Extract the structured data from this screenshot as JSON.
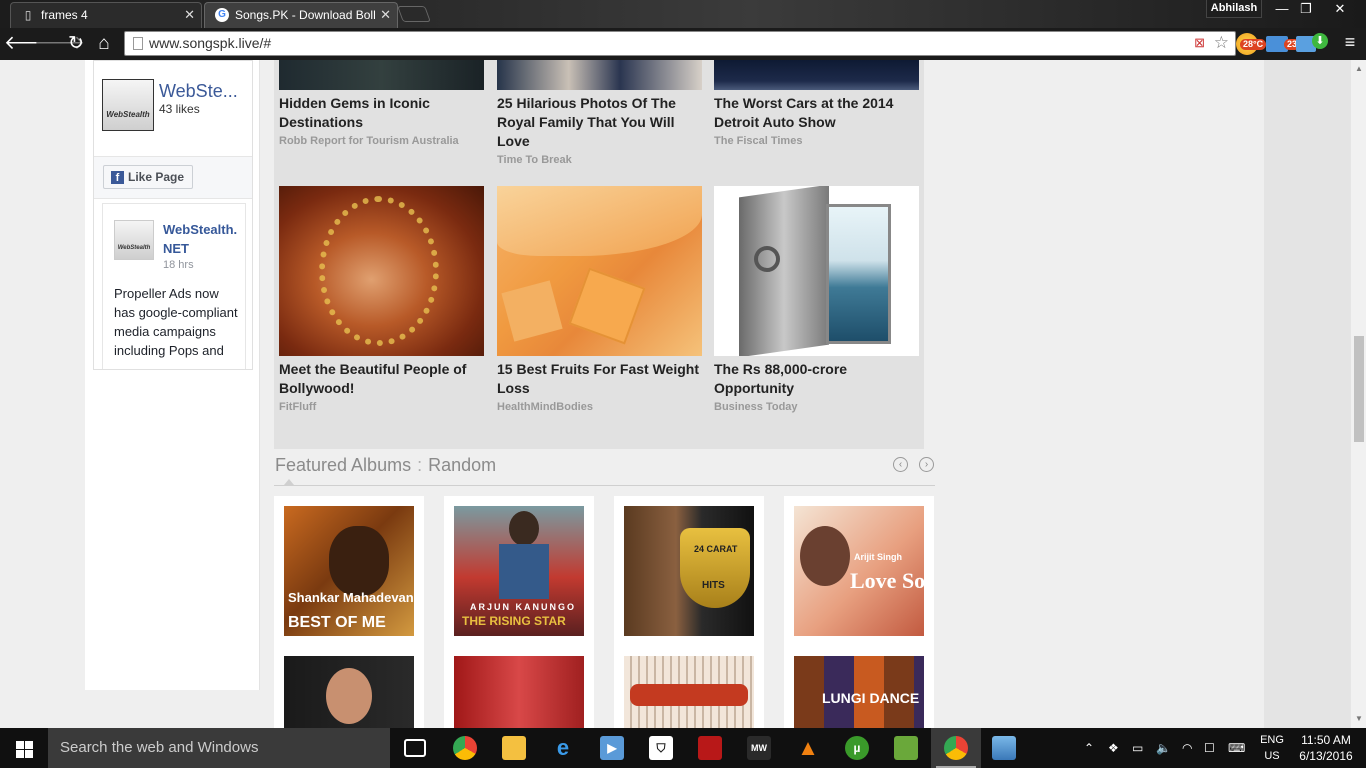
{
  "browser": {
    "tabs": [
      {
        "title": "frames 4",
        "close": "✕"
      },
      {
        "title": "Songs.PK - Download Boll",
        "close": "✕"
      }
    ],
    "profile": "Abhilash",
    "window_controls": {
      "minimize": "—",
      "restore": "❐",
      "close": "✕"
    },
    "url": "www.songspk.live/#",
    "ext_badges": {
      "weather": "28°C",
      "mail": "23"
    }
  },
  "facebook_widget": {
    "page_name": "WebSte...",
    "likes": "43 likes",
    "logo_text": "WebStealth",
    "like_button": "Like Page",
    "post": {
      "author": "WebStealth.NET",
      "time": "18 hrs",
      "text": "Propeller Ads now has google-compliant media campaigns including Pops and"
    }
  },
  "sponsored": [
    {
      "title": "Hidden Gems in Iconic Destinations",
      "source": "Robb Report for Tourism Australia"
    },
    {
      "title": "25 Hilarious Photos Of The Royal Family That You Will Love",
      "source": "Time To Break"
    },
    {
      "title": "The Worst Cars at the 2014 Detroit Auto Show",
      "source": "The Fiscal Times"
    },
    {
      "title": "Meet the Beautiful People of Bollywood!",
      "source": "FitFluff"
    },
    {
      "title": "15 Best Fruits For Fast Weight Loss",
      "source": "HealthMindBodies"
    },
    {
      "title": "The Rs 88,000-crore Opportunity",
      "source": "Business Today"
    }
  ],
  "featured": {
    "title": "Featured Albums",
    "separator": ":",
    "mode": "Random",
    "albums": [
      {
        "line1": "Shankar Mahadevan",
        "line2": "BEST OF ME"
      },
      {
        "line1": "ARJUN KANUNGO",
        "line2": "THE RISING STAR"
      },
      {
        "line1": "24 CARAT",
        "line2": "HITS"
      },
      {
        "line1": "Arijit Singh",
        "line2": "Love Songs"
      },
      {
        "line1": "",
        "line2": ""
      },
      {
        "line1": "",
        "line2": ""
      },
      {
        "line1": "",
        "line2": ""
      },
      {
        "line1": "",
        "line2": "LUNGI DANCE"
      }
    ]
  },
  "taskbar": {
    "search_placeholder": "Search the web and Windows",
    "language": "ENG",
    "region": "US",
    "time": "11:50 AM",
    "date": "6/13/2016"
  }
}
